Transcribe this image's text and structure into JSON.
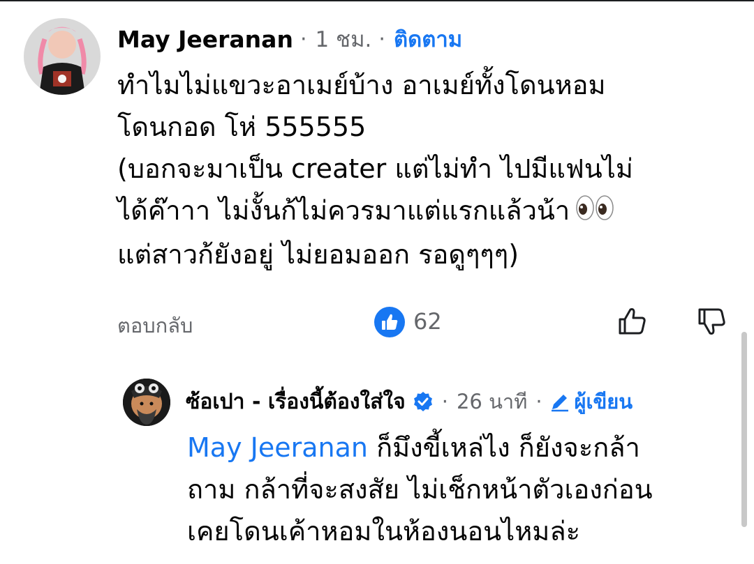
{
  "comment": {
    "author": "May Jeeranan",
    "time": "1 ชม.",
    "separator": "·",
    "follow_label": "ติดตาม",
    "text_lines": [
      "ทำไมไม่แขวะอาเมย์บ้าง อาเมย์ทั้งโดนหอม",
      "โดนกอด โห่ 555555",
      "(บอกจะมาเป็น creater แต่ไม่ทำ ไปมีแฟนไม่",
      "ได้ค๊าาา ไม่งั้นก้ไม่ควรมาแต่แรกแล้วน้า",
      "แต่สาวก้ยังอยู่ ไม่ยอมออก รอดูๆๆๆ)"
    ],
    "emoji": "eyes-emoji",
    "reply_label": "ตอบกลับ",
    "like_count": "62",
    "icons": {
      "like_badge": "thumb-up-icon",
      "like": "thumb-up-outline-icon",
      "dislike": "thumb-down-outline-icon"
    }
  },
  "reply": {
    "author": "ซ้อเปา - เรื่องนี้ต้องใส่ใจ",
    "separator": "·",
    "time": "26 นาที",
    "author_badge": "ผู้เขียน",
    "mention": "May Jeeranan",
    "text_lines": [
      "ก็มึงขี้เหล่ไง ก็ยังจะกล้า",
      "ถาม กล้าที่จะสงสัย ไม่เช็กหน้าตัวเองก่อน",
      "เคยโดนเค้าหอมในห้องนอนไหมล่ะ"
    ],
    "icons": {
      "verified": "verified-badge-icon",
      "author": "pencil-icon"
    }
  },
  "colors": {
    "link": "#1877f2",
    "secondary": "#65676b",
    "text": "#050505"
  }
}
